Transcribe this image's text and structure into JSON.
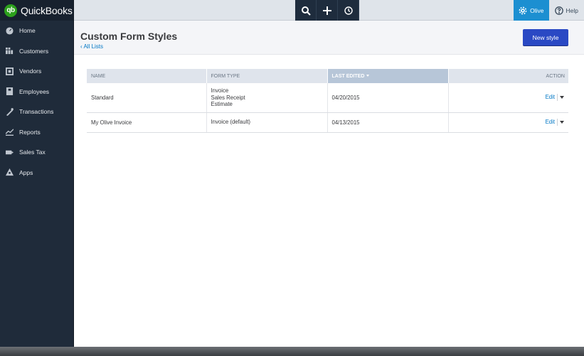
{
  "brand": {
    "logo_text": "qb",
    "name": "QuickBooks",
    "logo_color": "#2ca01c"
  },
  "sidebar": {
    "items": [
      {
        "label": "Home",
        "icon": "dashboard-icon"
      },
      {
        "label": "Customers",
        "icon": "customers-icon"
      },
      {
        "label": "Vendors",
        "icon": "vendors-icon"
      },
      {
        "label": "Employees",
        "icon": "employees-icon"
      },
      {
        "label": "Transactions",
        "icon": "transactions-icon"
      },
      {
        "label": "Reports",
        "icon": "reports-icon"
      },
      {
        "label": "Sales Tax",
        "icon": "sales-tax-icon"
      },
      {
        "label": "Apps",
        "icon": "apps-icon"
      }
    ]
  },
  "topbar": {
    "quick_actions": [
      "search-icon",
      "plus-icon",
      "recent-icon"
    ],
    "company_label": "Olive",
    "help_label": "Help",
    "accent_color": "#1c8fd1"
  },
  "header": {
    "title": "Custom Form Styles",
    "back_link": "All Lists",
    "new_button": "New style",
    "button_color": "#2a49c4"
  },
  "table": {
    "columns": [
      "NAME",
      "FORM TYPE",
      "LAST EDITED",
      "ACTION"
    ],
    "sorted_column": "LAST EDITED",
    "rows": [
      {
        "name": "Standard",
        "form_type": [
          "Invoice",
          "Sales Receipt",
          "Estimate"
        ],
        "last_edited": "04/20/2015",
        "action": "Edit"
      },
      {
        "name": "My Olive Invoice",
        "form_type": [
          "Invoice (default)"
        ],
        "last_edited": "04/13/2015",
        "action": "Edit"
      }
    ]
  }
}
